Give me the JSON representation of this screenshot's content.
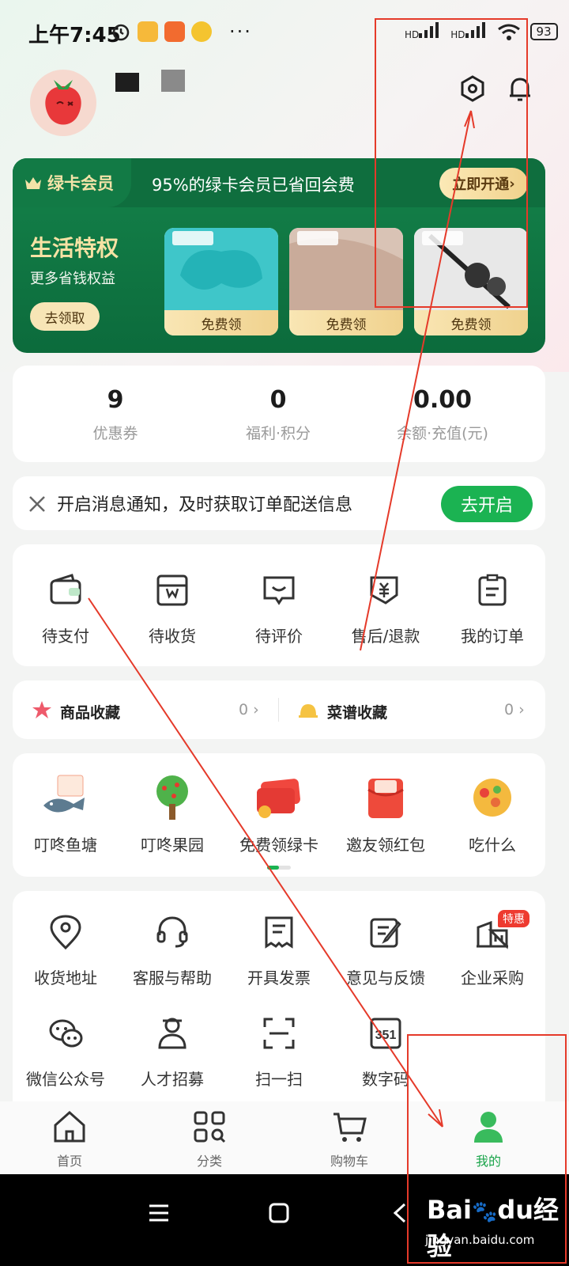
{
  "status": {
    "time": "上午7:45",
    "battery": "93",
    "signal1": "HD",
    "signal2": "HD",
    "more": "···"
  },
  "vip": {
    "badge": "绿卡会员",
    "tagline": "95%的绿卡会员已省回会费",
    "open_button": "立即开通",
    "title": "生活特权",
    "subtitle": "更多省钱权益",
    "claim_button": "去领取",
    "products": [
      {
        "button": "免费领",
        "color": "#3fc6c9"
      },
      {
        "button": "免费领",
        "color": "#d9c3b5"
      },
      {
        "button": "免费领",
        "color": "#5a5a5a"
      }
    ]
  },
  "stats": [
    {
      "value": "9",
      "label": "优惠券"
    },
    {
      "value": "0",
      "label": "福利·积分"
    },
    {
      "value": "0.00",
      "label": "余额·充值(元)"
    }
  ],
  "notification": {
    "text": "开启消息通知，及时获取订单配送信息",
    "button": "去开启"
  },
  "orders": [
    {
      "label": "待支付",
      "icon": "wallet-icon"
    },
    {
      "label": "待收货",
      "icon": "package-icon"
    },
    {
      "label": "待评价",
      "icon": "review-icon"
    },
    {
      "label": "售后/退款",
      "icon": "refund-icon"
    },
    {
      "label": "我的订单",
      "icon": "order-list-icon"
    }
  ],
  "favorites": {
    "goods_label": "商品收藏",
    "goods_count": "0",
    "recipe_label": "菜谱收藏",
    "recipe_count": "0"
  },
  "promos": [
    {
      "label": "叮咚鱼塘",
      "icon": "fish-icon"
    },
    {
      "label": "叮咚果园",
      "icon": "tree-icon"
    },
    {
      "label": "免费领绿卡",
      "icon": "green-card-icon"
    },
    {
      "label": "邀友领红包",
      "icon": "red-packet-icon"
    },
    {
      "label": "吃什么",
      "icon": "food-bowl-icon"
    }
  ],
  "services": [
    {
      "label": "收货地址",
      "icon": "location-icon"
    },
    {
      "label": "客服与帮助",
      "icon": "headset-icon"
    },
    {
      "label": "开具发票",
      "icon": "invoice-icon"
    },
    {
      "label": "意见与反馈",
      "icon": "feedback-icon"
    },
    {
      "label": "企业采购",
      "icon": "enterprise-icon",
      "badge": "特惠"
    },
    {
      "label": "微信公众号",
      "icon": "wechat-icon"
    },
    {
      "label": "人才招募",
      "icon": "recruit-icon"
    },
    {
      "label": "扫一扫",
      "icon": "scan-icon"
    },
    {
      "label": "数字码",
      "icon": "digital-code-icon"
    }
  ],
  "tabs": [
    {
      "label": "首页",
      "icon": "home-icon"
    },
    {
      "label": "分类",
      "icon": "category-icon"
    },
    {
      "label": "购物车",
      "icon": "cart-icon"
    },
    {
      "label": "我的",
      "icon": "profile-icon",
      "active": true
    }
  ],
  "watermark": {
    "text": "经验",
    "url": "jingyan.baidu.com"
  },
  "colors": {
    "brand_green": "#1bb352",
    "vip_green": "#0f6e3e",
    "gold": "#f1d28c",
    "annotation_red": "#e53a2a"
  }
}
